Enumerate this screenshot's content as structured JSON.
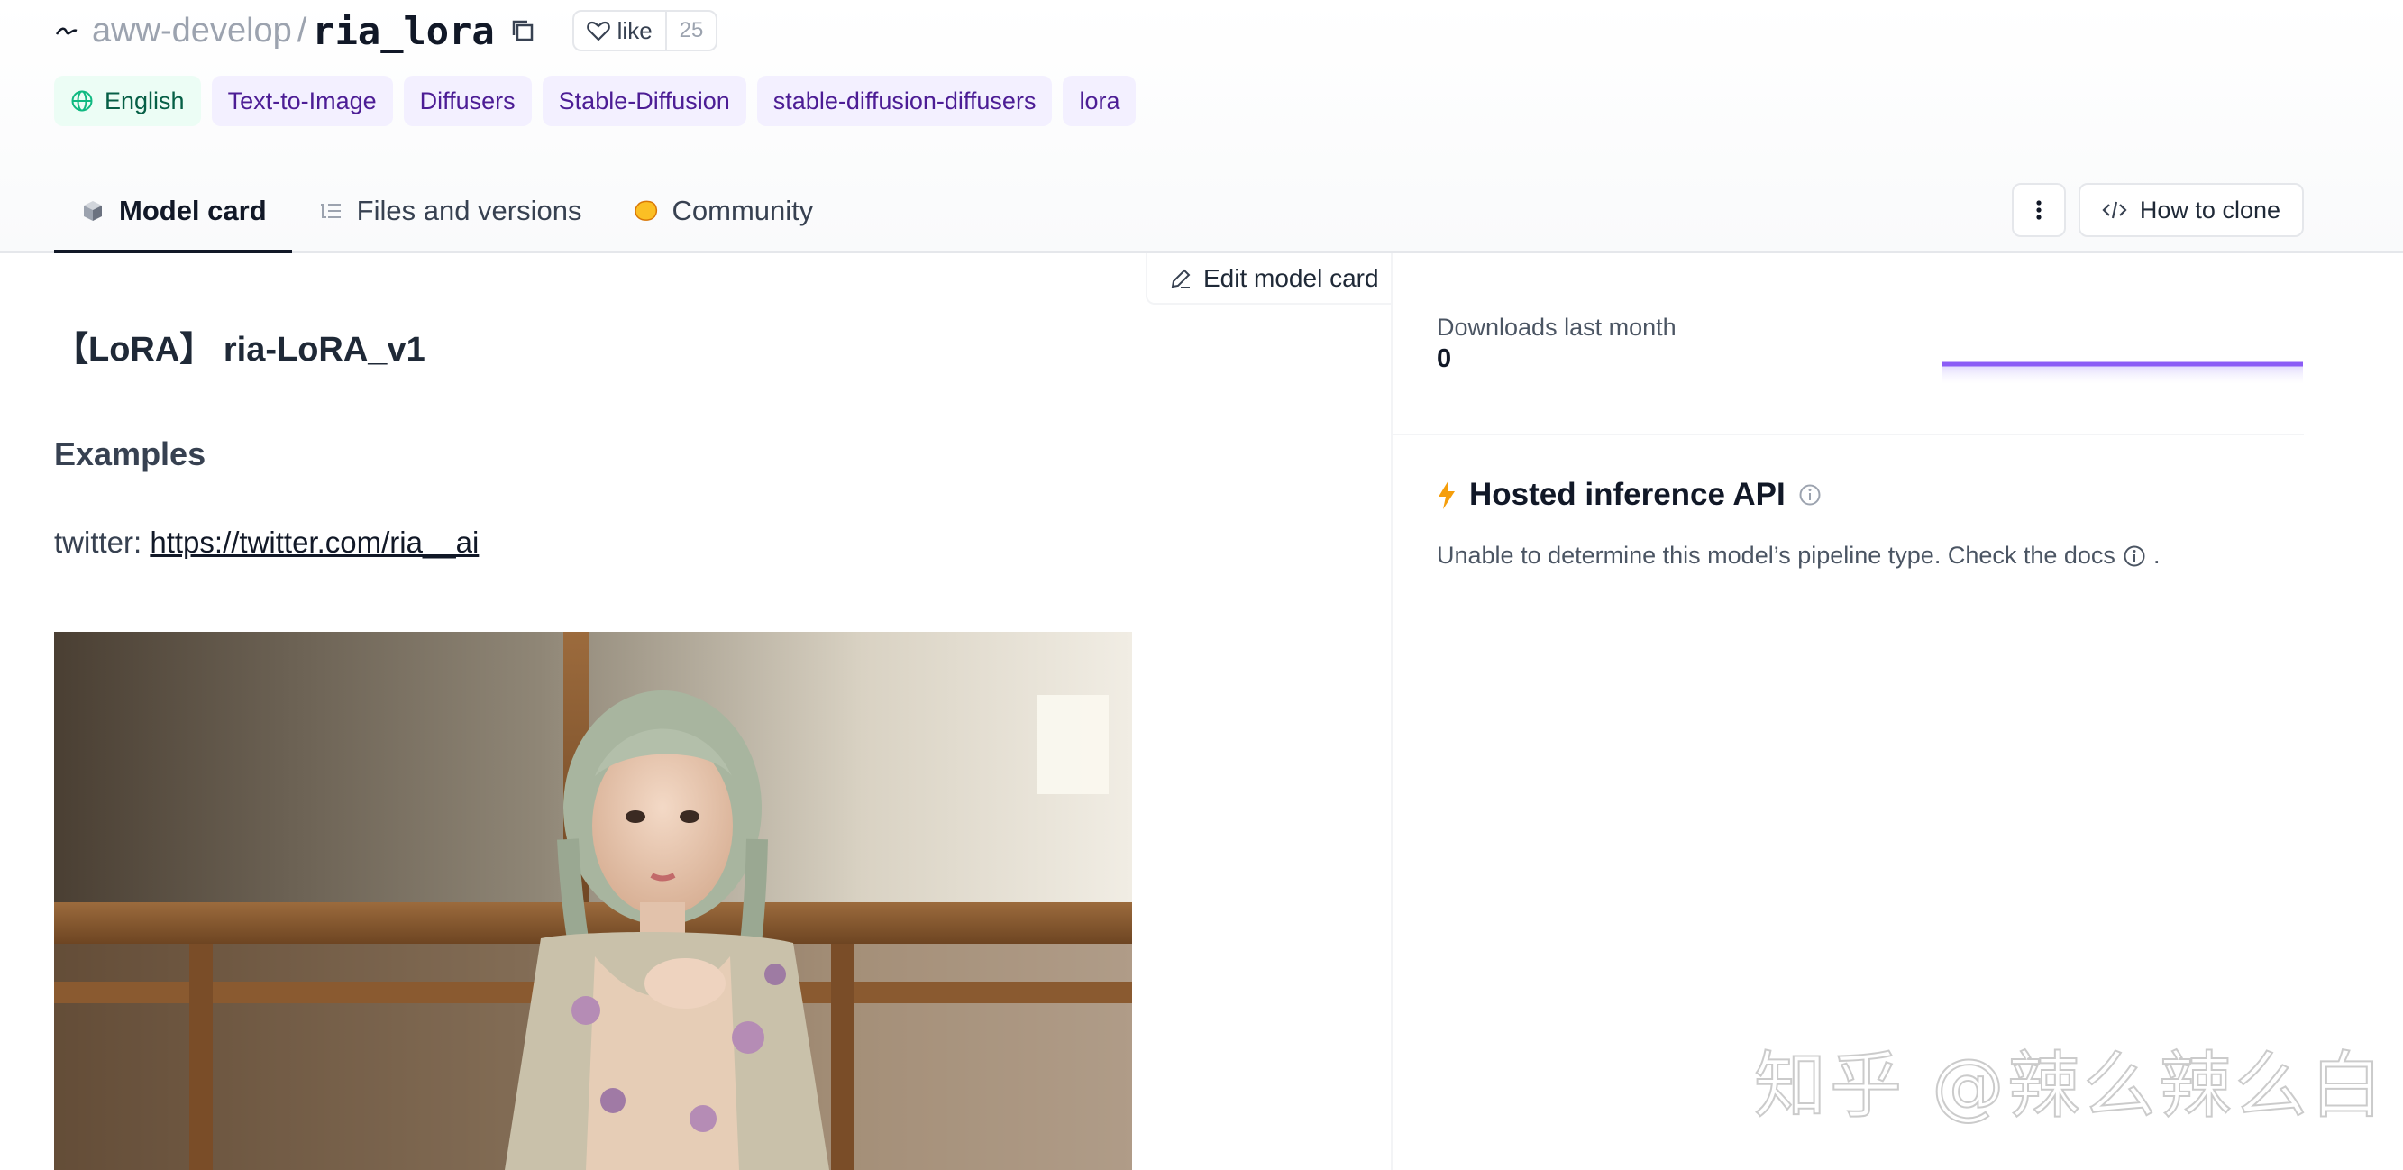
{
  "repo": {
    "owner": "aww-develop",
    "separator": "/",
    "name": "ria_lora"
  },
  "like": {
    "label": "like",
    "count": "25"
  },
  "tags": [
    {
      "label": "English",
      "kind": "language",
      "icon": "globe-icon"
    },
    {
      "label": "Text-to-Image",
      "kind": "task"
    },
    {
      "label": "Diffusers",
      "kind": "library"
    },
    {
      "label": "Stable-Diffusion",
      "kind": "other"
    },
    {
      "label": "stable-diffusion-diffusers",
      "kind": "other"
    },
    {
      "label": "lora",
      "kind": "other"
    }
  ],
  "tabs": [
    {
      "label": "Model card",
      "icon": "cube-icon",
      "active": true
    },
    {
      "label": "Files and versions",
      "icon": "files-icon",
      "active": false
    },
    {
      "label": "Community",
      "icon": "community-icon",
      "active": false
    }
  ],
  "header_actions": {
    "more_icon": "vertical-dots-icon",
    "clone_label": "How to clone"
  },
  "model_card": {
    "edit_label": "Edit model card",
    "title": "【LoRA】 ria-LoRA_v1",
    "section_heading": "Examples",
    "twitter_prefix": "twitter:",
    "twitter_link": "https://twitter.com/ria__ai"
  },
  "sidebar": {
    "downloads_label": "Downloads last month",
    "downloads_value": "0",
    "api_title": "Hosted inference API",
    "api_text": "Unable to determine this model’s pipeline type. Check the docs",
    "api_text_end": "."
  },
  "watermark": "知乎 @辣么辣么白",
  "colors": {
    "accent_purple": "#8b5cf6",
    "tag_bg": "#f3f0ff",
    "tag_text": "#4c1d95",
    "lang_tag_bg": "#ecfdf5",
    "lang_tag_text": "#065f46",
    "bolt": "#f59e0b"
  }
}
